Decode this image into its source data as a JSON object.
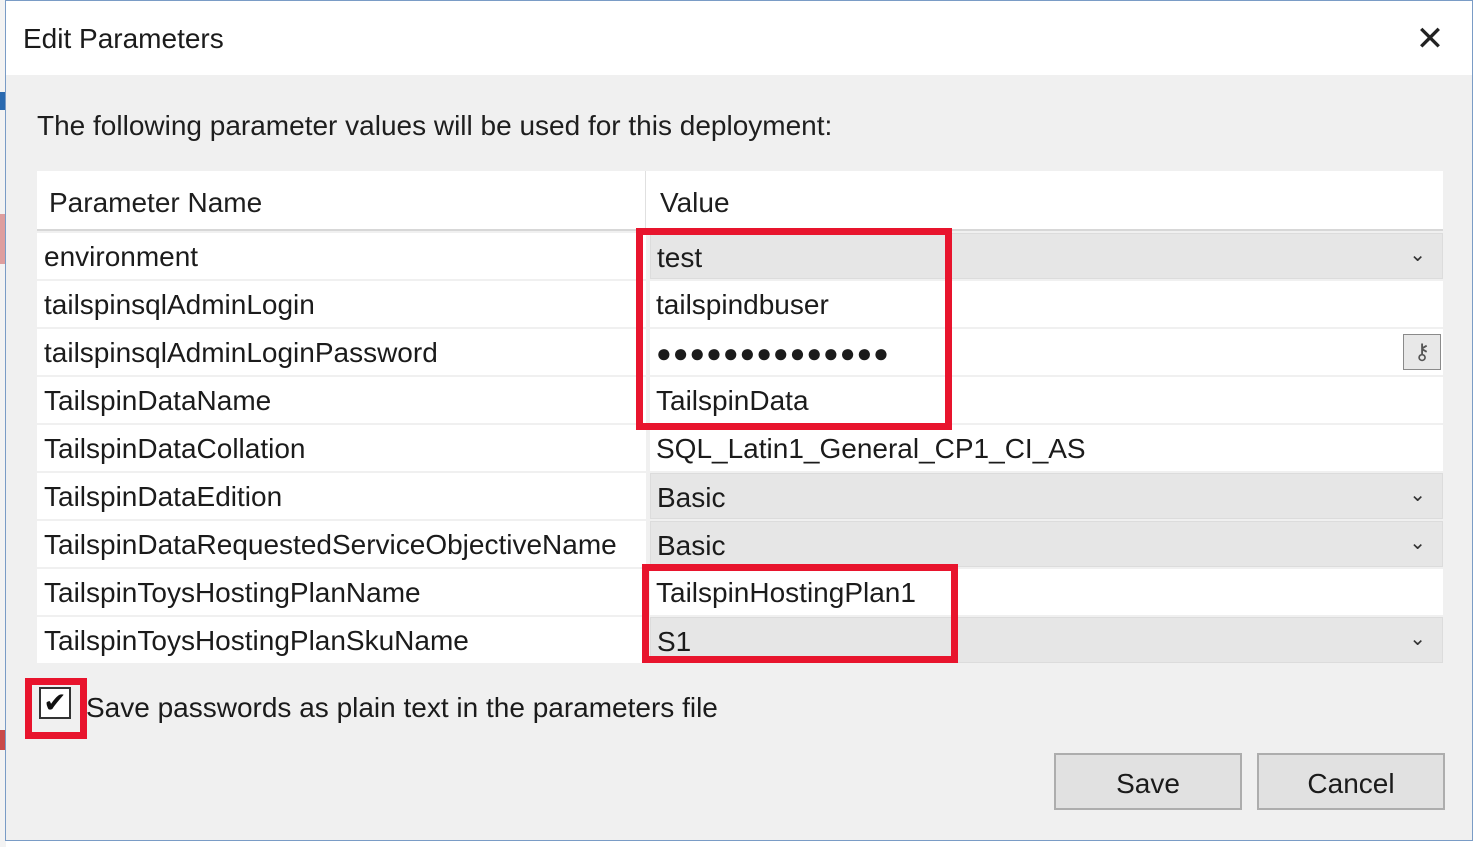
{
  "dialog": {
    "title": "Edit Parameters",
    "close_glyph": "✕",
    "intro": "The following parameter values will be used for this deployment:"
  },
  "grid": {
    "header_name": "Parameter Name",
    "header_value": "Value",
    "rows": [
      {
        "name": "environment",
        "value": "test",
        "kind": "combo"
      },
      {
        "name": "tailspinsqlAdminLogin",
        "value": "tailspindbuser",
        "kind": "text"
      },
      {
        "name": "tailspinsqlAdminLoginPassword",
        "value": "●●●●●●●●●●●●●●",
        "kind": "password"
      },
      {
        "name": "TailspinDataName",
        "value": "TailspinData",
        "kind": "text"
      },
      {
        "name": "TailspinDataCollation",
        "value": "SQL_Latin1_General_CP1_CI_AS",
        "kind": "text"
      },
      {
        "name": "TailspinDataEdition",
        "value": "Basic",
        "kind": "combo"
      },
      {
        "name": "TailspinDataRequestedServiceObjectiveName",
        "value": "Basic",
        "kind": "combo"
      },
      {
        "name": "TailspinToysHostingPlanName",
        "value": "TailspinHostingPlan1",
        "kind": "text"
      },
      {
        "name": "TailspinToysHostingPlanSkuName",
        "value": "S1",
        "kind": "combo"
      }
    ],
    "chevron_glyph": "⌄",
    "key_icon": "key-icon",
    "key_glyph": "⚷"
  },
  "options": {
    "save_passwords_label": "Save passwords as plain text in the parameters file",
    "save_passwords_checked": true,
    "check_glyph": "✔"
  },
  "buttons": {
    "save_label": "Save",
    "cancel_label": "Cancel"
  },
  "colors": {
    "highlight": "#e8142d",
    "dialog_bg": "#f0f0f0"
  }
}
